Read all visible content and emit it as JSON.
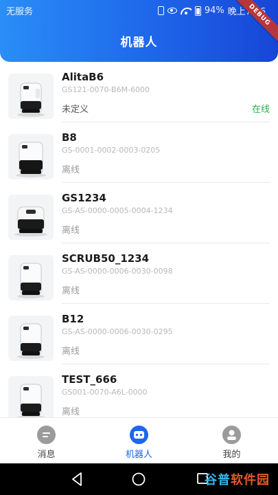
{
  "status_bar": {
    "carrier": "无服务",
    "battery": "94%",
    "time": "晚上7:56"
  },
  "header": {
    "title": "机器人"
  },
  "debug_banner": "DEBUG",
  "robots": [
    {
      "name": "AlitaB6",
      "serial": "GS121-0070-B6M-6000",
      "status": "未定义",
      "state": "在线"
    },
    {
      "name": "B8",
      "serial": "GS-0001-0002-0003-0205",
      "status": "离线",
      "state": ""
    },
    {
      "name": "GS1234",
      "serial": "GS-AS-0000-0005-0004-1234",
      "status": "离线",
      "state": ""
    },
    {
      "name": "SCRUB50_1234",
      "serial": "GS-AS-0000-0006-0030-0098",
      "status": "离线",
      "state": ""
    },
    {
      "name": "B12",
      "serial": "GS-AS-0000-0006-0030-0295",
      "status": "离线",
      "state": ""
    },
    {
      "name": "TEST_666",
      "serial": "GS001-0070-A6L-0000",
      "status": "离线",
      "state": ""
    }
  ],
  "bottom_nav": {
    "items": [
      {
        "label": "消息",
        "icon": "message-icon",
        "active": false
      },
      {
        "label": "机器人",
        "icon": "robot-icon",
        "active": true
      },
      {
        "label": "我的",
        "icon": "person-icon",
        "active": false
      }
    ]
  },
  "watermark": "谷普软件园",
  "colors": {
    "accent": "#1e66ea",
    "online": "#27b24a",
    "debug": "#b5363b"
  }
}
